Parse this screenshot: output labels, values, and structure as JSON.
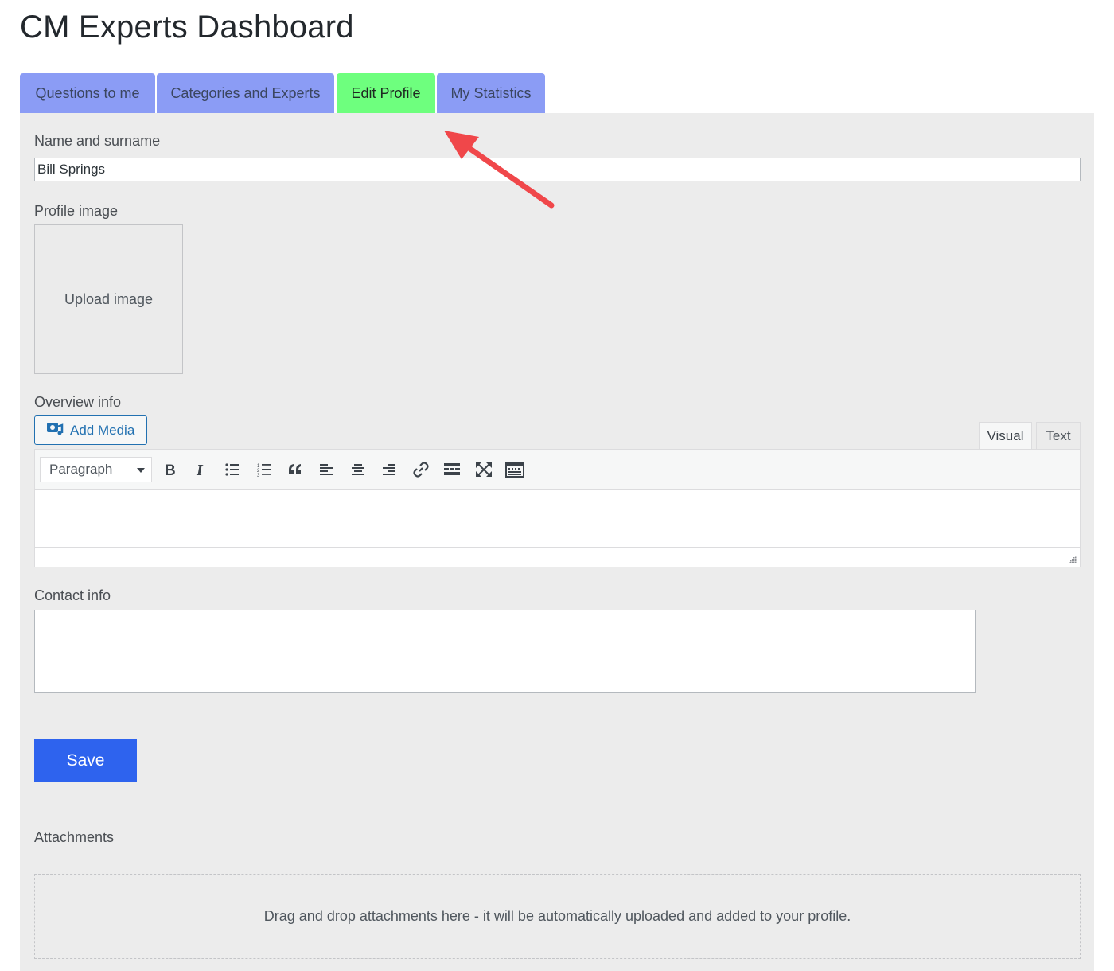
{
  "page": {
    "title": "CM Experts Dashboard"
  },
  "tabs": [
    {
      "label": "Questions to me",
      "active": false
    },
    {
      "label": "Categories and Experts",
      "active": false
    },
    {
      "label": "Edit Profile",
      "active": true
    },
    {
      "label": "My Statistics",
      "active": false
    }
  ],
  "form": {
    "name_label": "Name and surname",
    "name_value": "Bill Springs",
    "profile_image_label": "Profile image",
    "upload_image_label": "Upload image",
    "overview_label": "Overview info",
    "add_media_label": "Add Media",
    "editor_mode_visual": "Visual",
    "editor_mode_text": "Text",
    "format_select_value": "Paragraph",
    "toolbar_icons": [
      "bold-icon",
      "italic-icon",
      "bullet-list-icon",
      "numbered-list-icon",
      "blockquote-icon",
      "align-left-icon",
      "align-center-icon",
      "align-right-icon",
      "link-icon",
      "read-more-icon",
      "fullscreen-icon",
      "toolbar-toggle-icon"
    ],
    "contact_label": "Contact info",
    "save_label": "Save",
    "attachments_label": "Attachments",
    "dropzone_text": "Drag and drop attachments here - it will be automatically uploaded and added to your profile."
  },
  "colors": {
    "tab_inactive": "#8b9cf5",
    "tab_active": "#6eff7e",
    "panel_bg": "#ececec",
    "save_button": "#2e63ee",
    "annotation_arrow": "#f0474a"
  }
}
